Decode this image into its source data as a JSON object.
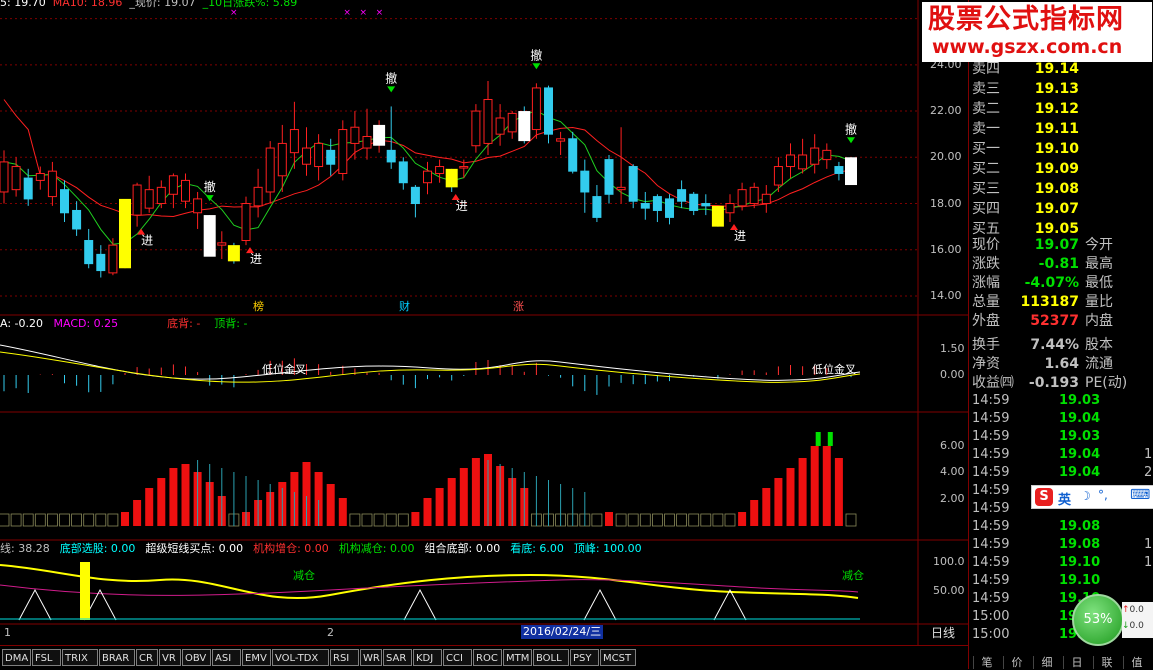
{
  "colors": {
    "up": "#ff2020",
    "down": "#33ccee",
    "yellow": "#ffff00",
    "white": "#ffffff",
    "green": "#00e000",
    "magenta": "#ff00ff",
    "frame": "#7f0000",
    "bg": "#000000"
  },
  "top_legend": {
    "ma5": "5: 19.70",
    "ma10": "MA10: 18.96",
    "price": "_现价: 19.07",
    "pct": "_10日涨跌%: 5.89"
  },
  "price_axis": [
    "26.00",
    "24.00",
    "22.00",
    "20.00",
    "18.00",
    "16.00",
    "14.00"
  ],
  "signals": {
    "cancel": "撤",
    "enter": "进",
    "labels": [
      "榜",
      "财",
      "涨"
    ]
  },
  "macd": {
    "dea": "A: -0.20",
    "macd": "MACD: 0.25",
    "bottom_div": "底背: -",
    "top_div": "顶背: -",
    "cross": "低位金叉",
    "axis": [
      "1.50",
      "0.00"
    ]
  },
  "panel3": {
    "axis": [
      "6.00",
      "4.00",
      "2.00"
    ]
  },
  "panel4": {
    "legend": [
      {
        "t": "线: 38.28",
        "c": "#c0c0c0"
      },
      {
        "t": "底部选股: 0.00",
        "c": "#00ffff"
      },
      {
        "t": "超级短线买点: 0.00",
        "c": "#ffffff"
      },
      {
        "t": "机构增仓: 0.00",
        "c": "#ff3030"
      },
      {
        "t": "机构减仓: 0.00",
        "c": "#00e000"
      },
      {
        "t": "组合底部: 0.00",
        "c": "#ffffff"
      },
      {
        "t": "看底: 6.00",
        "c": "#00ffff"
      },
      {
        "t": "顶峰: 100.00",
        "c": "#00ffff"
      }
    ],
    "reduce": "减仓",
    "axis": [
      "100.0",
      "50.00"
    ]
  },
  "time_axis": {
    "m1": "1",
    "m2": "2",
    "date": "2016/02/24/三",
    "period": "日线"
  },
  "tabs": [
    "DMA",
    "FSL",
    "TRIX",
    "BRAR",
    "CR",
    "VR",
    "OBV",
    "ASI",
    "EMV",
    "VOL-TDX",
    "RSI",
    "WR",
    "SAR",
    "KDJ",
    "CCI",
    "ROC",
    "MTM",
    "BOLL",
    "PSY",
    "MCST"
  ],
  "watermark": {
    "line1": "股票公式指标网",
    "line2": "www.gszx.com.cn"
  },
  "orderbook": [
    {
      "k": "卖四",
      "v": "19.14"
    },
    {
      "k": "卖三",
      "v": "19.13"
    },
    {
      "k": "卖二",
      "v": "19.12"
    },
    {
      "k": "卖一",
      "v": "19.11"
    },
    {
      "k": "买一",
      "v": "19.10"
    },
    {
      "k": "买二",
      "v": "19.09"
    },
    {
      "k": "买三",
      "v": "19.08"
    },
    {
      "k": "买四",
      "v": "19.07"
    },
    {
      "k": "买五",
      "v": "19.05"
    }
  ],
  "stats": [
    {
      "k": "现价",
      "v": "19.07",
      "vc": "#00e000",
      "k2": "今开"
    },
    {
      "k": "涨跌",
      "v": "-0.81",
      "vc": "#00e000",
      "k2": "最高"
    },
    {
      "k": "涨幅",
      "v": "-4.07%",
      "vc": "#00e000",
      "k2": "最低"
    },
    {
      "k": "总量",
      "v": "113187",
      "vc": "#ffff00",
      "k2": "量比"
    },
    {
      "k": "外盘",
      "v": "52377",
      "vc": "#ff3030",
      "k2": "内盘"
    },
    {
      "k": "换手",
      "v": "7.44%",
      "vc": "#c0c0c0",
      "k2": "股本"
    },
    {
      "k": "净资",
      "v": "1.64",
      "vc": "#c0c0c0",
      "k2": "流通"
    },
    {
      "k": "收益㈣",
      "v": "-0.193",
      "vc": "#c0c0c0",
      "k2": "PE(动)"
    }
  ],
  "ticks": [
    {
      "t": "14:59",
      "p": "19.03",
      "n": ""
    },
    {
      "t": "14:59",
      "p": "19.04",
      "n": ""
    },
    {
      "t": "14:59",
      "p": "19.03",
      "n": ""
    },
    {
      "t": "14:59",
      "p": "19.04",
      "n": "1"
    },
    {
      "t": "14:59",
      "p": "19.04",
      "n": "2"
    },
    {
      "t": "14:59",
      "p": "",
      "n": ""
    },
    {
      "t": "14:59",
      "p": "",
      "n": ""
    },
    {
      "t": "14:59",
      "p": "19.08",
      "n": ""
    },
    {
      "t": "14:59",
      "p": "19.08",
      "n": "1"
    },
    {
      "t": "14:59",
      "p": "19.10",
      "n": "1"
    },
    {
      "t": "14:59",
      "p": "19.10",
      "n": ""
    },
    {
      "t": "14:59",
      "p": "19.10",
      "n": ""
    },
    {
      "t": "15:00",
      "p": "19.10",
      "n": ""
    },
    {
      "t": "15:00",
      "p": "19.",
      "n": ""
    }
  ],
  "ime": {
    "label": "英"
  },
  "gauge": {
    "value": "53%"
  },
  "bottom_tabs": [
    "笔",
    "价",
    "细",
    "日",
    "联",
    "值"
  ],
  "chart_data": {
    "type": "candlestick",
    "ylim": [
      14,
      26
    ],
    "candles": [
      [
        18.5,
        19.8,
        18.0,
        20.3
      ],
      [
        18.6,
        19.6,
        18.3,
        20.0
      ],
      [
        19.1,
        18.2,
        17.9,
        19.5
      ],
      [
        19.0,
        19.3,
        18.6,
        19.6
      ],
      [
        18.3,
        19.4,
        17.9,
        19.8
      ],
      [
        18.6,
        17.6,
        17.2,
        19.0
      ],
      [
        17.7,
        16.9,
        16.6,
        18.1
      ],
      [
        16.4,
        15.4,
        15.2,
        16.9
      ],
      [
        15.8,
        15.1,
        14.8,
        16.2
      ],
      [
        15.0,
        16.2,
        14.9,
        16.5
      ],
      [
        15.5,
        17.9,
        15.2,
        18.0
      ],
      [
        17.5,
        18.8,
        17.0,
        18.9
      ],
      [
        17.8,
        18.6,
        17.6,
        19.2
      ],
      [
        18.0,
        18.7,
        17.8,
        19.0
      ],
      [
        18.4,
        19.2,
        17.8,
        19.3
      ],
      [
        18.1,
        19.0,
        17.8,
        19.3
      ],
      [
        17.6,
        18.2,
        16.9,
        18.5
      ],
      [
        17.2,
        16.0,
        15.8,
        17.5
      ],
      [
        16.2,
        16.3,
        15.6,
        16.8
      ],
      [
        15.9,
        15.8,
        15.4,
        16.3
      ],
      [
        16.4,
        18.0,
        16.2,
        18.3
      ],
      [
        17.9,
        18.7,
        17.4,
        19.5
      ],
      [
        18.5,
        20.4,
        18.0,
        20.7
      ],
      [
        19.2,
        20.6,
        18.5,
        21.4
      ],
      [
        20.2,
        21.2,
        19.5,
        22.4
      ],
      [
        19.7,
        20.4,
        19.2,
        21.3
      ],
      [
        19.6,
        20.6,
        19.0,
        21.0
      ],
      [
        20.3,
        19.7,
        19.2,
        20.8
      ],
      [
        19.3,
        21.2,
        19.0,
        21.6
      ],
      [
        20.6,
        21.3,
        19.9,
        22.0
      ],
      [
        20.4,
        20.9,
        19.9,
        22.1
      ],
      [
        20.8,
        21.1,
        20.2,
        21.6
      ],
      [
        20.3,
        19.8,
        19.5,
        22.2
      ],
      [
        19.8,
        18.9,
        18.6,
        20.0
      ],
      [
        18.7,
        18.0,
        17.4,
        18.8
      ],
      [
        18.9,
        19.4,
        18.4,
        19.8
      ],
      [
        19.3,
        19.6,
        18.9,
        19.9
      ],
      [
        19.2,
        19.0,
        18.5,
        19.5
      ],
      [
        19.6,
        19.6,
        19.1,
        19.9
      ],
      [
        20.5,
        22.0,
        20.2,
        22.3
      ],
      [
        20.6,
        22.5,
        20.1,
        23.3
      ],
      [
        21.0,
        21.7,
        20.5,
        22.3
      ],
      [
        21.1,
        21.9,
        20.8,
        22.0
      ],
      [
        21.7,
        21.0,
        20.6,
        22.2
      ],
      [
        21.2,
        23.0,
        20.8,
        23.2
      ],
      [
        23.0,
        21.0,
        20.6,
        23.1
      ],
      [
        20.7,
        20.8,
        20.1,
        21.1
      ],
      [
        20.8,
        19.4,
        19.3,
        21.1
      ],
      [
        19.4,
        18.5,
        17.6,
        19.9
      ],
      [
        18.3,
        17.4,
        17.2,
        18.8
      ],
      [
        19.9,
        18.4,
        18.0,
        20.1
      ],
      [
        18.6,
        18.7,
        18.0,
        21.3
      ],
      [
        19.6,
        18.1,
        17.8,
        19.7
      ],
      [
        18.0,
        17.8,
        17.3,
        18.5
      ],
      [
        18.3,
        17.7,
        17.2,
        18.4
      ],
      [
        18.2,
        17.4,
        17.1,
        18.4
      ],
      [
        18.6,
        18.1,
        17.8,
        19.0
      ],
      [
        18.4,
        17.7,
        17.5,
        18.5
      ],
      [
        18.0,
        17.9,
        17.5,
        18.4
      ],
      [
        17.6,
        17.3,
        17.0,
        17.8
      ],
      [
        17.6,
        18.0,
        17.2,
        18.4
      ],
      [
        17.9,
        18.6,
        17.7,
        18.9
      ],
      [
        18.0,
        18.7,
        17.8,
        18.9
      ],
      [
        18.0,
        18.4,
        17.6,
        18.8
      ],
      [
        18.8,
        19.6,
        18.5,
        20.0
      ],
      [
        19.6,
        20.1,
        19.1,
        20.6
      ],
      [
        19.5,
        20.1,
        19.3,
        20.8
      ],
      [
        19.7,
        20.4,
        19.3,
        21.0
      ],
      [
        19.9,
        20.3,
        19.5,
        20.6
      ],
      [
        19.6,
        19.3,
        19.0,
        19.8
      ],
      [
        19.7,
        19.1,
        19.0,
        20.0
      ]
    ]
  }
}
